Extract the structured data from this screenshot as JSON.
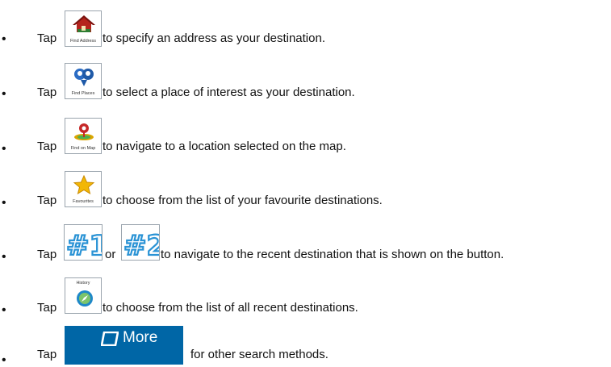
{
  "items": [
    {
      "tap": "Tap",
      "button_label": "Find Address",
      "text": "to specify an address as your destination."
    },
    {
      "tap": "Tap",
      "button_label": "Find Places",
      "text": "to select a place of interest as your destination."
    },
    {
      "tap": "Tap",
      "button_label": "Find on Map",
      "text": "to navigate to a location selected on the map."
    },
    {
      "tap": "Tap",
      "button_label": "Favourites",
      "text": "to choose from the list of your favourite destinations."
    },
    {
      "tap": "Tap",
      "button1_label": "#1",
      "or": "or",
      "button2_label": "#2",
      "text": "to navigate to the recent destination that is shown on the button."
    },
    {
      "tap": "Tap",
      "button_label": "History",
      "text": "to choose from the list of all recent destinations."
    },
    {
      "tap": "Tap",
      "button_label": "More",
      "text": "for other search methods."
    }
  ],
  "bullet": "•",
  "icons": {
    "find_address": "house-icon",
    "find_places": "people-pin-icon",
    "find_on_map": "map-pin-icon",
    "favourites": "star-icon",
    "history": "compass-icon",
    "more": "rectangle-icon"
  },
  "colors": {
    "more_button": "#0066a6",
    "number_outline": "#2a93d5"
  }
}
